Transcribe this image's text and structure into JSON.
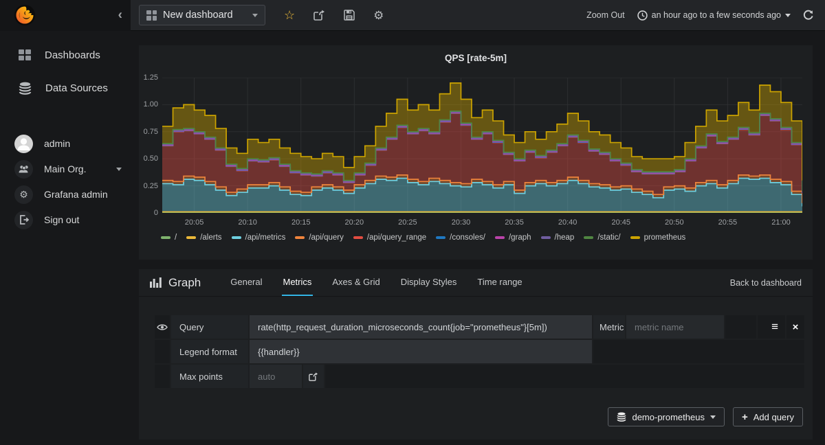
{
  "navbar": {
    "dashboard_title": "New dashboard",
    "zoom_out": "Zoom Out",
    "time_range": "an hour ago to a few seconds ago"
  },
  "sidebar": {
    "items": [
      {
        "label": "Dashboards"
      },
      {
        "label": "Data Sources"
      }
    ],
    "user_items": [
      {
        "label": "admin"
      },
      {
        "label": "Main Org."
      },
      {
        "label": "Grafana admin"
      },
      {
        "label": "Sign out"
      }
    ]
  },
  "editor": {
    "title": "Graph",
    "tabs": [
      "General",
      "Metrics",
      "Axes & Grid",
      "Display Styles",
      "Time range"
    ],
    "active_tab": "Metrics",
    "back": "Back to dashboard",
    "query_label": "Query",
    "query_value": "rate(http_request_duration_microseconds_count{job=\"prometheus\"}[5m])",
    "metric_label": "Metric",
    "metric_placeholder": "metric name",
    "legend_label": "Legend format",
    "legend_value": "{{handler}}",
    "maxpoints_label": "Max points",
    "maxpoints_placeholder": "auto",
    "datasource_button": "demo-prometheus",
    "add_query_button": "Add query"
  },
  "icons": {
    "menu_glyph": "≡",
    "close_glyph": "×",
    "gear_glyph": "⚙",
    "star_glyph": "☆",
    "chevron_left_glyph": "‹",
    "plus_glyph": "+"
  },
  "chart_data": {
    "type": "area",
    "title": "QPS [rate-5m]",
    "stacked": true,
    "ylim": [
      0,
      1.25
    ],
    "y_ticks": [
      "0",
      "0.25",
      "0.50",
      "0.75",
      "1.00",
      "1.25"
    ],
    "x_start": "20:02",
    "x_end": "21:02",
    "step_minutes": 1,
    "x_tick_labels": [
      "20:05",
      "20:10",
      "20:15",
      "20:20",
      "20:25",
      "20:30",
      "20:35",
      "20:40",
      "20:45",
      "20:50",
      "20:55",
      "21:00"
    ],
    "x_tick_indices": [
      3,
      8,
      13,
      18,
      23,
      28,
      33,
      38,
      43,
      48,
      53,
      58
    ],
    "legend_position": "bottom",
    "grid": true,
    "series": [
      {
        "name": "/",
        "color": "#7EB26D",
        "value": 0.005
      },
      {
        "name": "/alerts",
        "color": "#EAB839",
        "value": 0.005
      },
      {
        "name": "/api/metrics",
        "color": "#6ED0E0",
        "values": [
          0.26,
          0.25,
          0.3,
          0.29,
          0.25,
          0.2,
          0.15,
          0.18,
          0.22,
          0.22,
          0.24,
          0.2,
          0.16,
          0.15,
          0.2,
          0.22,
          0.2,
          0.17,
          0.22,
          0.26,
          0.3,
          0.29,
          0.31,
          0.27,
          0.25,
          0.28,
          0.26,
          0.24,
          0.23,
          0.27,
          0.25,
          0.22,
          0.25,
          0.17,
          0.24,
          0.26,
          0.24,
          0.26,
          0.29,
          0.26,
          0.23,
          0.22,
          0.2,
          0.21,
          0.18,
          0.16,
          0.13,
          0.2,
          0.21,
          0.19,
          0.24,
          0.26,
          0.22,
          0.26,
          0.31,
          0.3,
          0.31,
          0.27,
          0.25,
          0.16,
          0.05
        ]
      },
      {
        "name": "/api/query",
        "color": "#EF843C",
        "value": 0.03
      },
      {
        "name": "/api/query_range",
        "color": "#E24D42",
        "values": [
          0.32,
          0.46,
          0.42,
          0.4,
          0.39,
          0.34,
          0.24,
          0.17,
          0.22,
          0.21,
          0.21,
          0.19,
          0.17,
          0.16,
          0.1,
          0.11,
          0.11,
          0.07,
          0.09,
          0.14,
          0.24,
          0.35,
          0.44,
          0.42,
          0.47,
          0.41,
          0.54,
          0.64,
          0.54,
          0.37,
          0.44,
          0.39,
          0.25,
          0.27,
          0.28,
          0.21,
          0.28,
          0.32,
          0.37,
          0.35,
          0.3,
          0.28,
          0.24,
          0.19,
          0.16,
          0.16,
          0.19,
          0.12,
          0.13,
          0.25,
          0.32,
          0.41,
          0.38,
          0.38,
          0.42,
          0.38,
          0.55,
          0.54,
          0.48,
          0.43,
          0.09
        ]
      },
      {
        "name": "/consoles/",
        "color": "#1F78C1",
        "value": 0.003
      },
      {
        "name": "/graph",
        "color": "#BA43A9",
        "value": 0.004
      },
      {
        "name": "/heap",
        "color": "#705DA0",
        "value": 0.006
      },
      {
        "name": "/static/",
        "color": "#508642",
        "value": 0.007
      },
      {
        "name": "prometheus",
        "color": "#CCA300",
        "values": [
          0.16,
          0.2,
          0.22,
          0.2,
          0.2,
          0.18,
          0.15,
          0.14,
          0.18,
          0.16,
          0.17,
          0.15,
          0.16,
          0.15,
          0.14,
          0.16,
          0.15,
          0.12,
          0.15,
          0.16,
          0.2,
          0.22,
          0.24,
          0.2,
          0.22,
          0.2,
          0.24,
          0.26,
          0.22,
          0.18,
          0.2,
          0.18,
          0.16,
          0.15,
          0.17,
          0.15,
          0.17,
          0.18,
          0.2,
          0.18,
          0.16,
          0.16,
          0.15,
          0.14,
          0.12,
          0.12,
          0.12,
          0.12,
          0.12,
          0.15,
          0.18,
          0.22,
          0.19,
          0.2,
          0.23,
          0.21,
          0.26,
          0.25,
          0.23,
          0.2,
          0.1
        ]
      }
    ]
  }
}
